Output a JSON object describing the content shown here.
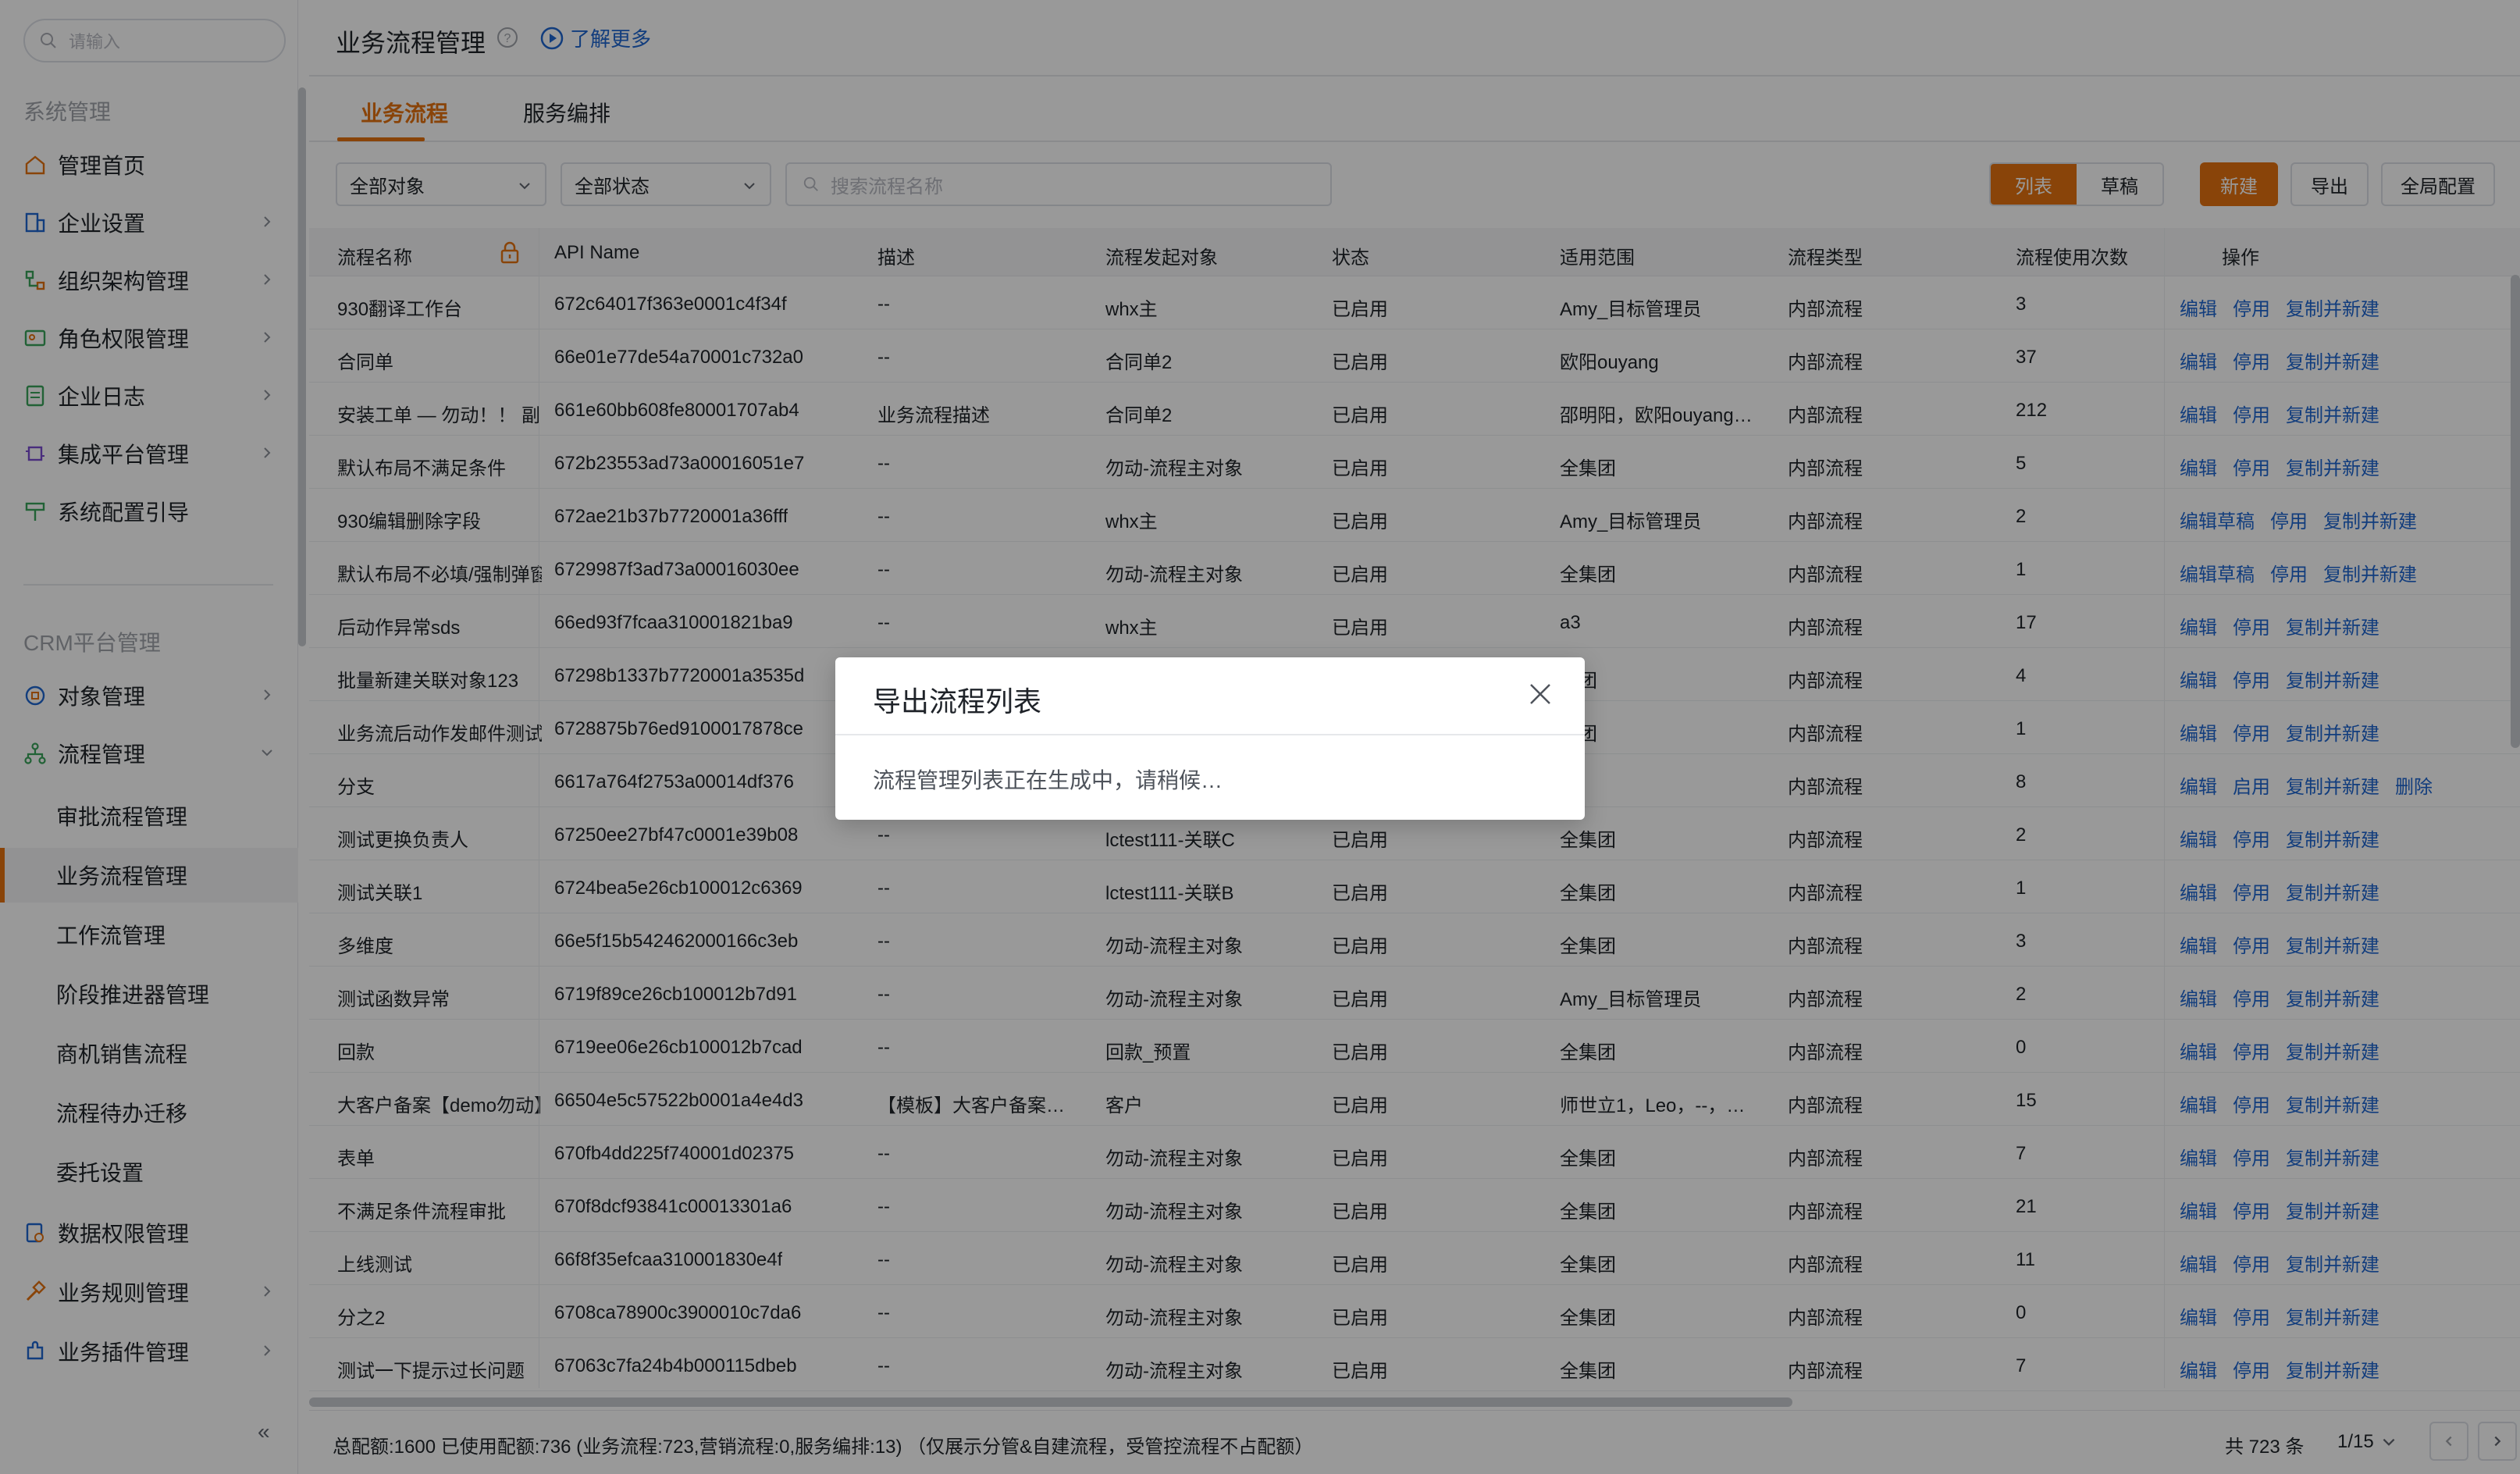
{
  "sidebar": {
    "search_placeholder": "请输入",
    "section1": "系统管理",
    "items1": [
      {
        "label": "管理首页",
        "icon": "home-icon"
      },
      {
        "label": "企业设置",
        "icon": "building-icon"
      },
      {
        "label": "组织架构管理",
        "icon": "org-icon"
      },
      {
        "label": "角色权限管理",
        "icon": "role-icon"
      },
      {
        "label": "企业日志",
        "icon": "log-icon"
      },
      {
        "label": "集成平台管理",
        "icon": "chip-icon"
      },
      {
        "label": "系统配置引导",
        "icon": "guide-icon"
      }
    ],
    "section2": "CRM平台管理",
    "items2": [
      {
        "label": "对象管理",
        "icon": "object-icon"
      },
      {
        "label": "流程管理",
        "icon": "flow-icon"
      }
    ],
    "subitems": [
      "审批流程管理",
      "业务流程管理",
      "工作流管理",
      "阶段推进器管理",
      "商机销售流程",
      "流程待办迁移",
      "委托设置"
    ],
    "items3": [
      {
        "label": "数据权限管理",
        "icon": "data-permission-icon"
      },
      {
        "label": "业务规则管理",
        "icon": "rule-icon"
      },
      {
        "label": "业务插件管理",
        "icon": "plugin-icon"
      }
    ],
    "collapse": "«"
  },
  "header": {
    "title": "业务流程管理",
    "learn_more": "了解更多"
  },
  "tabs": [
    "业务流程",
    "服务编排"
  ],
  "toolbar": {
    "object_select": "全部对象",
    "status_select": "全部状态",
    "search_placeholder": "搜索流程名称",
    "view_list": "列表",
    "view_draft": "草稿",
    "new_btn": "新建",
    "export_btn": "导出",
    "global_btn": "全局配置"
  },
  "table": {
    "columns": [
      "流程名称",
      "API Name",
      "描述",
      "流程发起对象",
      "状态",
      "适用范围",
      "流程类型",
      "流程使用次数",
      "操作"
    ],
    "rows": [
      {
        "name": "930翻译工作台",
        "api": "672c64017f363e0001c4f34f",
        "desc": "--",
        "obj": "whx主",
        "status": "已启用",
        "scope": "Amy_目标管理员",
        "type": "内部流程",
        "count": "3",
        "ops": [
          "编辑",
          "停用",
          "复制并新建"
        ]
      },
      {
        "name": "合同单",
        "api": "66e01e77de54a70001c732a0",
        "desc": "--",
        "obj": "合同单2",
        "status": "已启用",
        "scope": "欧阳ouyang",
        "type": "内部流程",
        "count": "37",
        "ops": [
          "编辑",
          "停用",
          "复制并新建"
        ]
      },
      {
        "name": "安装工单 — 勿动！！ 副",
        "api": "661e60bb608fe80001707ab4",
        "desc": "业务流程描述",
        "obj": "合同单2",
        "status": "已启用",
        "scope": "邵明阳，欧阳ouyang…",
        "type": "内部流程",
        "count": "212",
        "ops": [
          "编辑",
          "停用",
          "复制并新建"
        ]
      },
      {
        "name": "默认布局不满足条件",
        "api": "672b23553ad73a00016051e7",
        "desc": "--",
        "obj": "勿动-流程主对象",
        "status": "已启用",
        "scope": "全集团",
        "type": "内部流程",
        "count": "5",
        "ops": [
          "编辑",
          "停用",
          "复制并新建"
        ]
      },
      {
        "name": "930编辑删除字段",
        "api": "672ae21b37b7720001a36fff",
        "desc": "--",
        "obj": "whx主",
        "status": "已启用",
        "scope": "Amy_目标管理员",
        "type": "内部流程",
        "count": "2",
        "ops": [
          "编辑草稿",
          "停用",
          "复制并新建"
        ]
      },
      {
        "name": "默认布局不必填/强制弹窗",
        "api": "6729987f3ad73a00016030ee",
        "desc": "--",
        "obj": "勿动-流程主对象",
        "status": "已启用",
        "scope": "全集团",
        "type": "内部流程",
        "count": "1",
        "ops": [
          "编辑草稿",
          "停用",
          "复制并新建"
        ]
      },
      {
        "name": "后动作异常sds",
        "api": "66ed93f7fcaa310001821ba9",
        "desc": "--",
        "obj": "whx主",
        "status": "已启用",
        "scope": "a3",
        "type": "内部流程",
        "count": "17",
        "ops": [
          "编辑",
          "停用",
          "复制并新建"
        ]
      },
      {
        "name": "批量新建关联对象123",
        "api": "67298b1337b7720001a3535d",
        "desc": "",
        "obj": "",
        "status": "",
        "scope": "集团",
        "type": "内部流程",
        "count": "4",
        "ops": [
          "编辑",
          "停用",
          "复制并新建"
        ]
      },
      {
        "name": "业务流后动作发邮件测试",
        "api": "6728875b76ed9100017878ce",
        "desc": "",
        "obj": "",
        "status": "",
        "scope": "集团",
        "type": "内部流程",
        "count": "1",
        "ops": [
          "编辑",
          "停用",
          "复制并新建"
        ]
      },
      {
        "name": "分支",
        "api": "6617a764f2753a00014df376",
        "desc": "",
        "obj": "",
        "status": "",
        "scope": "",
        "type": "内部流程",
        "count": "8",
        "ops": [
          "编辑",
          "启用",
          "复制并新建",
          "删除"
        ]
      },
      {
        "name": "测试更换负责人",
        "api": "67250ee27bf47c0001e39b08",
        "desc": "--",
        "obj": "lctest111-关联C",
        "status": "已启用",
        "scope": "全集团",
        "type": "内部流程",
        "count": "2",
        "ops": [
          "编辑",
          "停用",
          "复制并新建"
        ]
      },
      {
        "name": "测试关联1",
        "api": "6724bea5e26cb100012c6369",
        "desc": "--",
        "obj": "lctest111-关联B",
        "status": "已启用",
        "scope": "全集团",
        "type": "内部流程",
        "count": "1",
        "ops": [
          "编辑",
          "停用",
          "复制并新建"
        ]
      },
      {
        "name": "多维度",
        "api": "66e5f15b542462000166c3eb",
        "desc": "--",
        "obj": "勿动-流程主对象",
        "status": "已启用",
        "scope": "全集团",
        "type": "内部流程",
        "count": "3",
        "ops": [
          "编辑",
          "停用",
          "复制并新建"
        ]
      },
      {
        "name": "测试函数异常",
        "api": "6719f89ce26cb100012b7d91",
        "desc": "--",
        "obj": "勿动-流程主对象",
        "status": "已启用",
        "scope": "Amy_目标管理员",
        "type": "内部流程",
        "count": "2",
        "ops": [
          "编辑",
          "停用",
          "复制并新建"
        ]
      },
      {
        "name": "回款",
        "api": "6719ee06e26cb100012b7cad",
        "desc": "--",
        "obj": "回款_预置",
        "status": "已启用",
        "scope": "全集团",
        "type": "内部流程",
        "count": "0",
        "ops": [
          "编辑",
          "停用",
          "复制并新建"
        ]
      },
      {
        "name": "大客户备案【demo勿动】",
        "api": "66504e5c57522b0001a4e4d3",
        "desc": "【模板】大客户备案…",
        "obj": "客户",
        "status": "已启用",
        "scope": "师世立1，Leo，--，…",
        "type": "内部流程",
        "count": "15",
        "ops": [
          "编辑",
          "停用",
          "复制并新建"
        ]
      },
      {
        "name": "表单",
        "api": "670fb4dd225f740001d02375",
        "desc": "--",
        "obj": "勿动-流程主对象",
        "status": "已启用",
        "scope": "全集团",
        "type": "内部流程",
        "count": "7",
        "ops": [
          "编辑",
          "停用",
          "复制并新建"
        ]
      },
      {
        "name": "不满足条件流程审批",
        "api": "670f8dcf93841c00013301a6",
        "desc": "--",
        "obj": "勿动-流程主对象",
        "status": "已启用",
        "scope": "全集团",
        "type": "内部流程",
        "count": "21",
        "ops": [
          "编辑",
          "停用",
          "复制并新建"
        ]
      },
      {
        "name": "上线测试",
        "api": "66f8f35efcaa310001830e4f",
        "desc": "--",
        "obj": "勿动-流程主对象",
        "status": "已启用",
        "scope": "全集团",
        "type": "内部流程",
        "count": "11",
        "ops": [
          "编辑",
          "停用",
          "复制并新建"
        ]
      },
      {
        "name": "分之2",
        "api": "6708ca78900c3900010c7da6",
        "desc": "--",
        "obj": "勿动-流程主对象",
        "status": "已启用",
        "scope": "全集团",
        "type": "内部流程",
        "count": "0",
        "ops": [
          "编辑",
          "停用",
          "复制并新建"
        ]
      },
      {
        "name": "测试一下提示过长问题",
        "api": "67063c7fa24b4b000115dbeb",
        "desc": "--",
        "obj": "勿动-流程主对象",
        "status": "已启用",
        "scope": "全集团",
        "type": "内部流程",
        "count": "7",
        "ops": [
          "编辑",
          "停用",
          "复制并新建"
        ]
      }
    ]
  },
  "footer": {
    "quota": "总配额:1600 已使用配额:736  (业务流程:723,营销流程:0,服务编排:13) （仅展示分管&自建流程，受管控流程不占配额）",
    "total": "共 723 条",
    "page": "1/15"
  },
  "modal": {
    "title": "导出流程列表",
    "message": "流程管理列表正在生成中，请稍候…"
  },
  "colors": {
    "accent": "#e5720f",
    "link": "#1e66d0"
  }
}
